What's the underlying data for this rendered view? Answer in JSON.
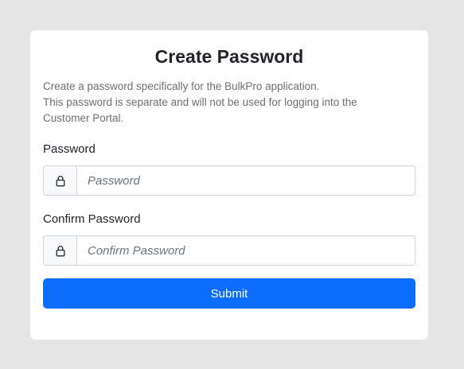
{
  "form": {
    "title": "Create Password",
    "description_lines": [
      "Create a password specifically for the BulkPro application.",
      "This password is separate and will not be used for logging into the",
      "Customer Portal."
    ],
    "password": {
      "label": "Password",
      "placeholder": "Password",
      "value": "",
      "icon": "lock-icon"
    },
    "confirm_password": {
      "label": "Confirm Password",
      "placeholder": "Confirm Password",
      "value": "",
      "icon": "lock-icon"
    },
    "submit_label": "Submit"
  },
  "colors": {
    "page_background": "#e4e5e7",
    "card_background": "#ffffff",
    "primary": "#0d6efd",
    "muted_text": "#6c6f74",
    "border": "#ced4da"
  }
}
